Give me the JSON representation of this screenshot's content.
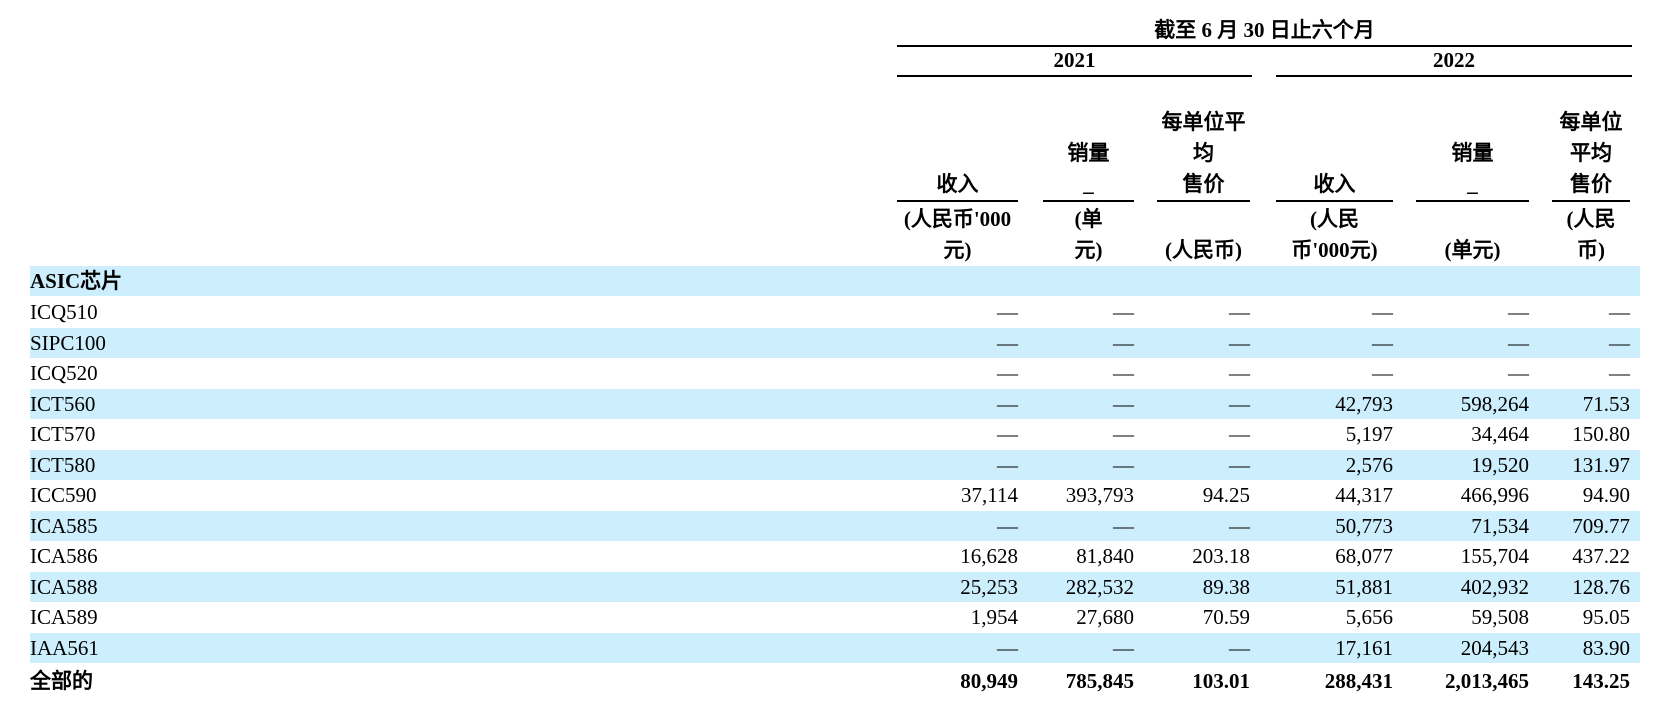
{
  "title": "截至 6 月 30 日止六个月",
  "years": [
    "2021",
    "2022"
  ],
  "columns": [
    {
      "name": [
        "收入"
      ],
      "unit": [
        "(人民币'000",
        "元)"
      ]
    },
    {
      "name": [
        "销量",
        "_"
      ],
      "unit": [
        "(单",
        "元)"
      ]
    },
    {
      "name": [
        "每单位平",
        "均",
        "售价"
      ],
      "unit": [
        "(人民币)"
      ]
    },
    {
      "name": [
        "收入"
      ],
      "unit": [
        "(人民",
        "币'000元)"
      ]
    },
    {
      "name": [
        "销量",
        "_"
      ],
      "unit": [
        "(单元)"
      ]
    },
    {
      "name": [
        "每单位",
        "平均",
        "售价"
      ],
      "unit": [
        "(人民",
        "币)"
      ]
    }
  ],
  "section_label": "ASIC芯片",
  "rows": [
    {
      "label": "ICQ510",
      "values": [
        "—",
        "—",
        "—",
        "—",
        "—",
        "—"
      ]
    },
    {
      "label": "SIPC100",
      "values": [
        "—",
        "—",
        "—",
        "—",
        "—",
        "—"
      ]
    },
    {
      "label": "ICQ520",
      "values": [
        "—",
        "—",
        "—",
        "—",
        "—",
        "—"
      ]
    },
    {
      "label": "ICT560",
      "values": [
        "—",
        "—",
        "—",
        "42,793",
        "598,264",
        "71.53"
      ]
    },
    {
      "label": "ICT570",
      "values": [
        "—",
        "—",
        "—",
        "5,197",
        "34,464",
        "150.80"
      ]
    },
    {
      "label": "ICT580",
      "values": [
        "—",
        "—",
        "—",
        "2,576",
        "19,520",
        "131.97"
      ]
    },
    {
      "label": "ICC590",
      "values": [
        "37,114",
        "393,793",
        "94.25",
        "44,317",
        "466,996",
        "94.90"
      ]
    },
    {
      "label": "ICA585",
      "values": [
        "—",
        "—",
        "—",
        "50,773",
        "71,534",
        "709.77"
      ]
    },
    {
      "label": "ICA586",
      "values": [
        "16,628",
        "81,840",
        "203.18",
        "68,077",
        "155,704",
        "437.22"
      ]
    },
    {
      "label": "ICA588",
      "values": [
        "25,253",
        "282,532",
        "89.38",
        "51,881",
        "402,932",
        "128.76"
      ]
    },
    {
      "label": "ICA589",
      "values": [
        "1,954",
        "27,680",
        "70.59",
        "5,656",
        "59,508",
        "95.05"
      ]
    },
    {
      "label": "IAA561",
      "values": [
        "—",
        "—",
        "—",
        "17,161",
        "204,543",
        "83.90"
      ]
    }
  ],
  "total": {
    "label": "全部的",
    "values": [
      "80,949",
      "785,845",
      "103.01",
      "288,431",
      "2,013,465",
      "143.25"
    ]
  },
  "colors": {
    "row_highlight": "#cdeefc",
    "text": "#000000"
  }
}
